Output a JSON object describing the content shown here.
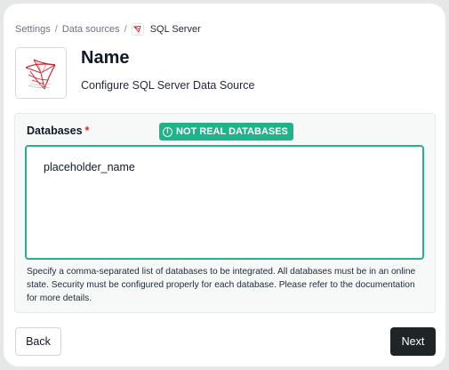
{
  "breadcrumb": {
    "items": [
      "Settings",
      "Data sources"
    ],
    "separator": "/",
    "current": "SQL Server",
    "current_icon": "sql-server-icon"
  },
  "header": {
    "logo_icon": "sql-server-logo-icon",
    "title": "Name",
    "subtitle": "Configure SQL Server Data Source"
  },
  "form": {
    "databases": {
      "label": "Databases",
      "required_marker": "*",
      "badge": "NOT REAL DATABASES",
      "badge_icon": "info-icon",
      "value": "placeholder_name",
      "help": "Specify a comma-separated list of databases to be integrated. All databases must be in an online state. Security must be configured properly for each database. Please refer to the documentation for more details."
    }
  },
  "footer": {
    "back_label": "Back",
    "next_label": "Next"
  },
  "colors": {
    "accent": "#20b38a",
    "required": "#dc2626",
    "primary_button": "#1f2426",
    "logo_red": "#c8232c"
  }
}
